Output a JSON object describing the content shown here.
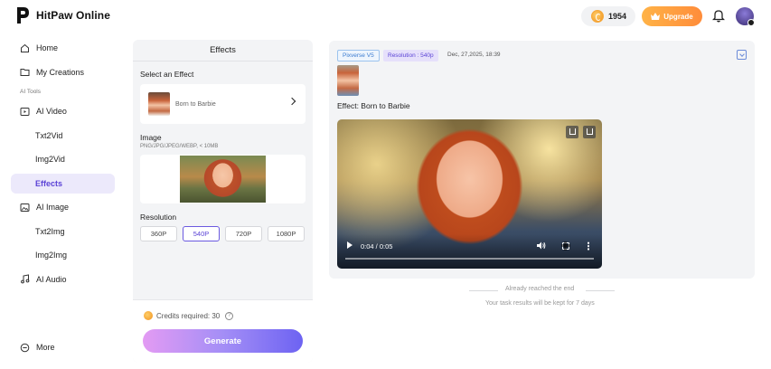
{
  "app": {
    "name": "HitPaw Online"
  },
  "header": {
    "credits": "1954",
    "upgrade_label": "Upgrade"
  },
  "sidebar": {
    "items": [
      {
        "label": "Home"
      },
      {
        "label": "My Creations"
      }
    ],
    "section_label": "AI Tools",
    "tools": [
      {
        "label": "AI Video"
      },
      {
        "label": "Txt2Vid"
      },
      {
        "label": "Img2Vid"
      },
      {
        "label": "Effects"
      },
      {
        "label": "AI Image"
      },
      {
        "label": "Txt2Img"
      },
      {
        "label": "Img2Img"
      },
      {
        "label": "AI Audio"
      }
    ],
    "more_label": "More"
  },
  "effects_panel": {
    "title": "Effects",
    "select_label": "Select an Effect",
    "selected_effect": "Born to Barbie",
    "image_label": "Image",
    "image_hint": "PNG/JPG/JPEG/WEBP, < 10MB",
    "resolution_label": "Resolution",
    "resolutions": [
      "360P",
      "540P",
      "720P",
      "1080P"
    ],
    "selected_resolution": "540P",
    "credits_required": "Credits required: 30",
    "generate_label": "Generate"
  },
  "result_panel": {
    "model_tag": "Pixverse V5",
    "resolution_tag": "Resolution : 540p",
    "date": "Dec, 27,2025, 18:39",
    "effect_line": "Effect: Born to Barbie",
    "video_time": "0:04 / 0:05"
  },
  "footer": {
    "end_text": "Already reached the end",
    "keep_text": "Your task results will be kept for 7 days"
  }
}
